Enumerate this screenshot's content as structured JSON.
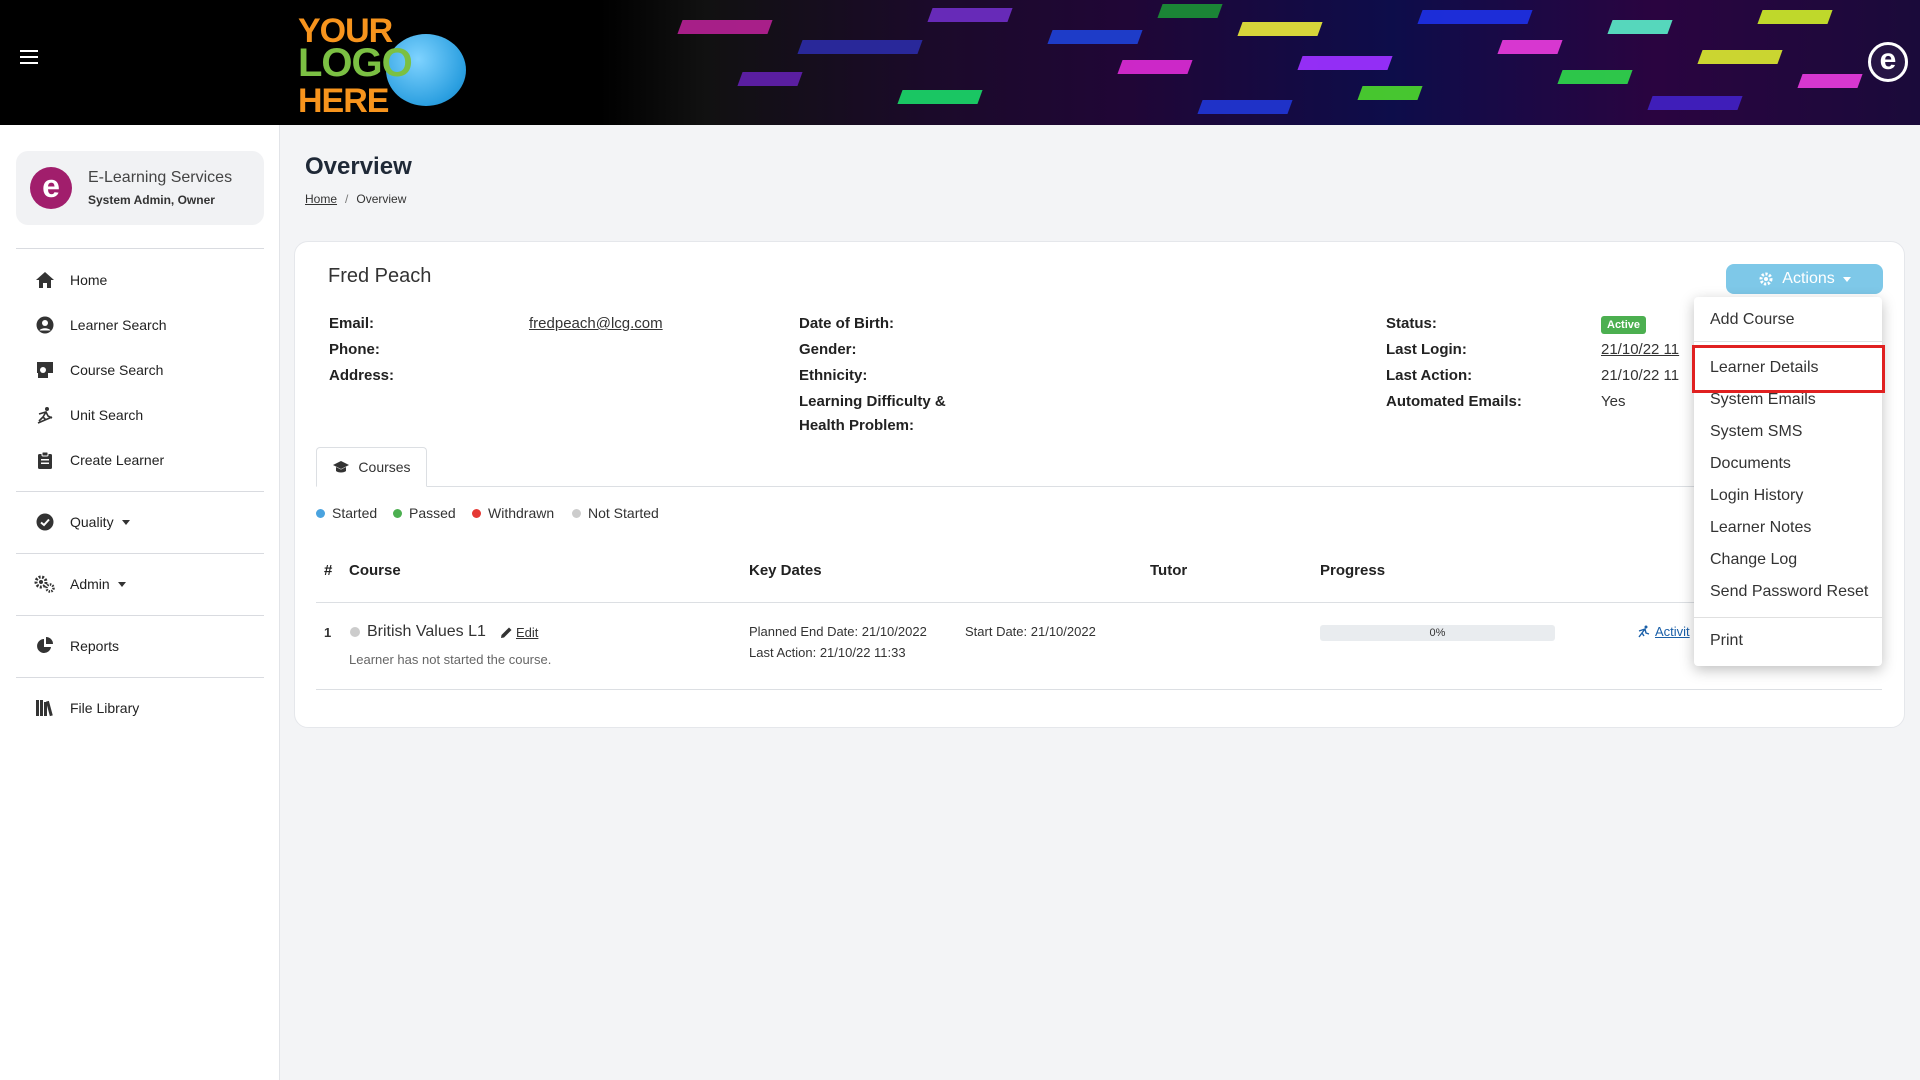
{
  "header": {
    "menu_icon": "hamburger-icon",
    "logo": {
      "line1": "YOUR",
      "line2": "LOGO",
      "line3": "HERE"
    },
    "brand_icon": "e-logo-icon"
  },
  "sidebar": {
    "org_name": "E-Learning Services",
    "org_role": "System Admin, Owner",
    "items": [
      {
        "label": "Home",
        "icon": "home-icon"
      },
      {
        "label": "Learner Search",
        "icon": "user-circle-icon"
      },
      {
        "label": "Course Search",
        "icon": "teacher-icon"
      },
      {
        "label": "Unit Search",
        "icon": "unit-icon"
      },
      {
        "label": "Create Learner",
        "icon": "clipboard-icon"
      },
      {
        "label": "Quality",
        "icon": "check-circle-icon"
      },
      {
        "label": "Admin",
        "icon": "gears-icon"
      },
      {
        "label": "Reports",
        "icon": "pie-chart-icon"
      },
      {
        "label": "File Library",
        "icon": "books-icon"
      }
    ]
  },
  "page": {
    "title": "Overview",
    "breadcrumb_home": "Home",
    "breadcrumb_sep": "/",
    "breadcrumb_current": "Overview"
  },
  "learner": {
    "name": "Fred Peach",
    "email_label": "Email:",
    "email": "fredpeach@lcg.com",
    "phone_label": "Phone:",
    "address_label": "Address:",
    "dob_label": "Date of Birth:",
    "gender_label": "Gender:",
    "ethnicity_label": "Ethnicity:",
    "ldd_label_1": "Learning Difficulty &",
    "ldd_label_2": "Health Problem:",
    "status_label": "Status:",
    "status": "Active",
    "last_login_label": "Last Login:",
    "last_login": "21/10/22 11",
    "last_action_label": "Last Action:",
    "last_action": "21/10/22 11",
    "auto_emails_label": "Automated Emails:",
    "auto_emails": "Yes"
  },
  "actions": {
    "label": "Actions",
    "menu": [
      "Add Course",
      "Learner Details",
      "System Emails",
      "System SMS",
      "Documents",
      "Login History",
      "Learner Notes",
      "Change Log",
      "Send Password Reset",
      "Print"
    ]
  },
  "tabs": {
    "courses": "Courses"
  },
  "legend": [
    {
      "label": "Started",
      "color": "#4aa3df"
    },
    {
      "label": "Passed",
      "color": "#4caf50"
    },
    {
      "label": "Withdrawn",
      "color": "#e53935"
    },
    {
      "label": "Not Started",
      "color": "#cccccc"
    }
  ],
  "table": {
    "headers": {
      "num": "#",
      "course": "Course",
      "dates": "Key Dates",
      "tutor": "Tutor",
      "progress": "Progress"
    },
    "rows": [
      {
        "num": "1",
        "course": "British Values L1",
        "edit": "Edit",
        "note": "Learner has not started the course.",
        "planned_end": "Planned End Date: 21/10/2022",
        "start": "Start Date: 21/10/2022",
        "last_action": "Last Action: 21/10/22 11:33",
        "progress_text": "0%",
        "progress_value": 0,
        "activity": "Activit"
      }
    ]
  }
}
